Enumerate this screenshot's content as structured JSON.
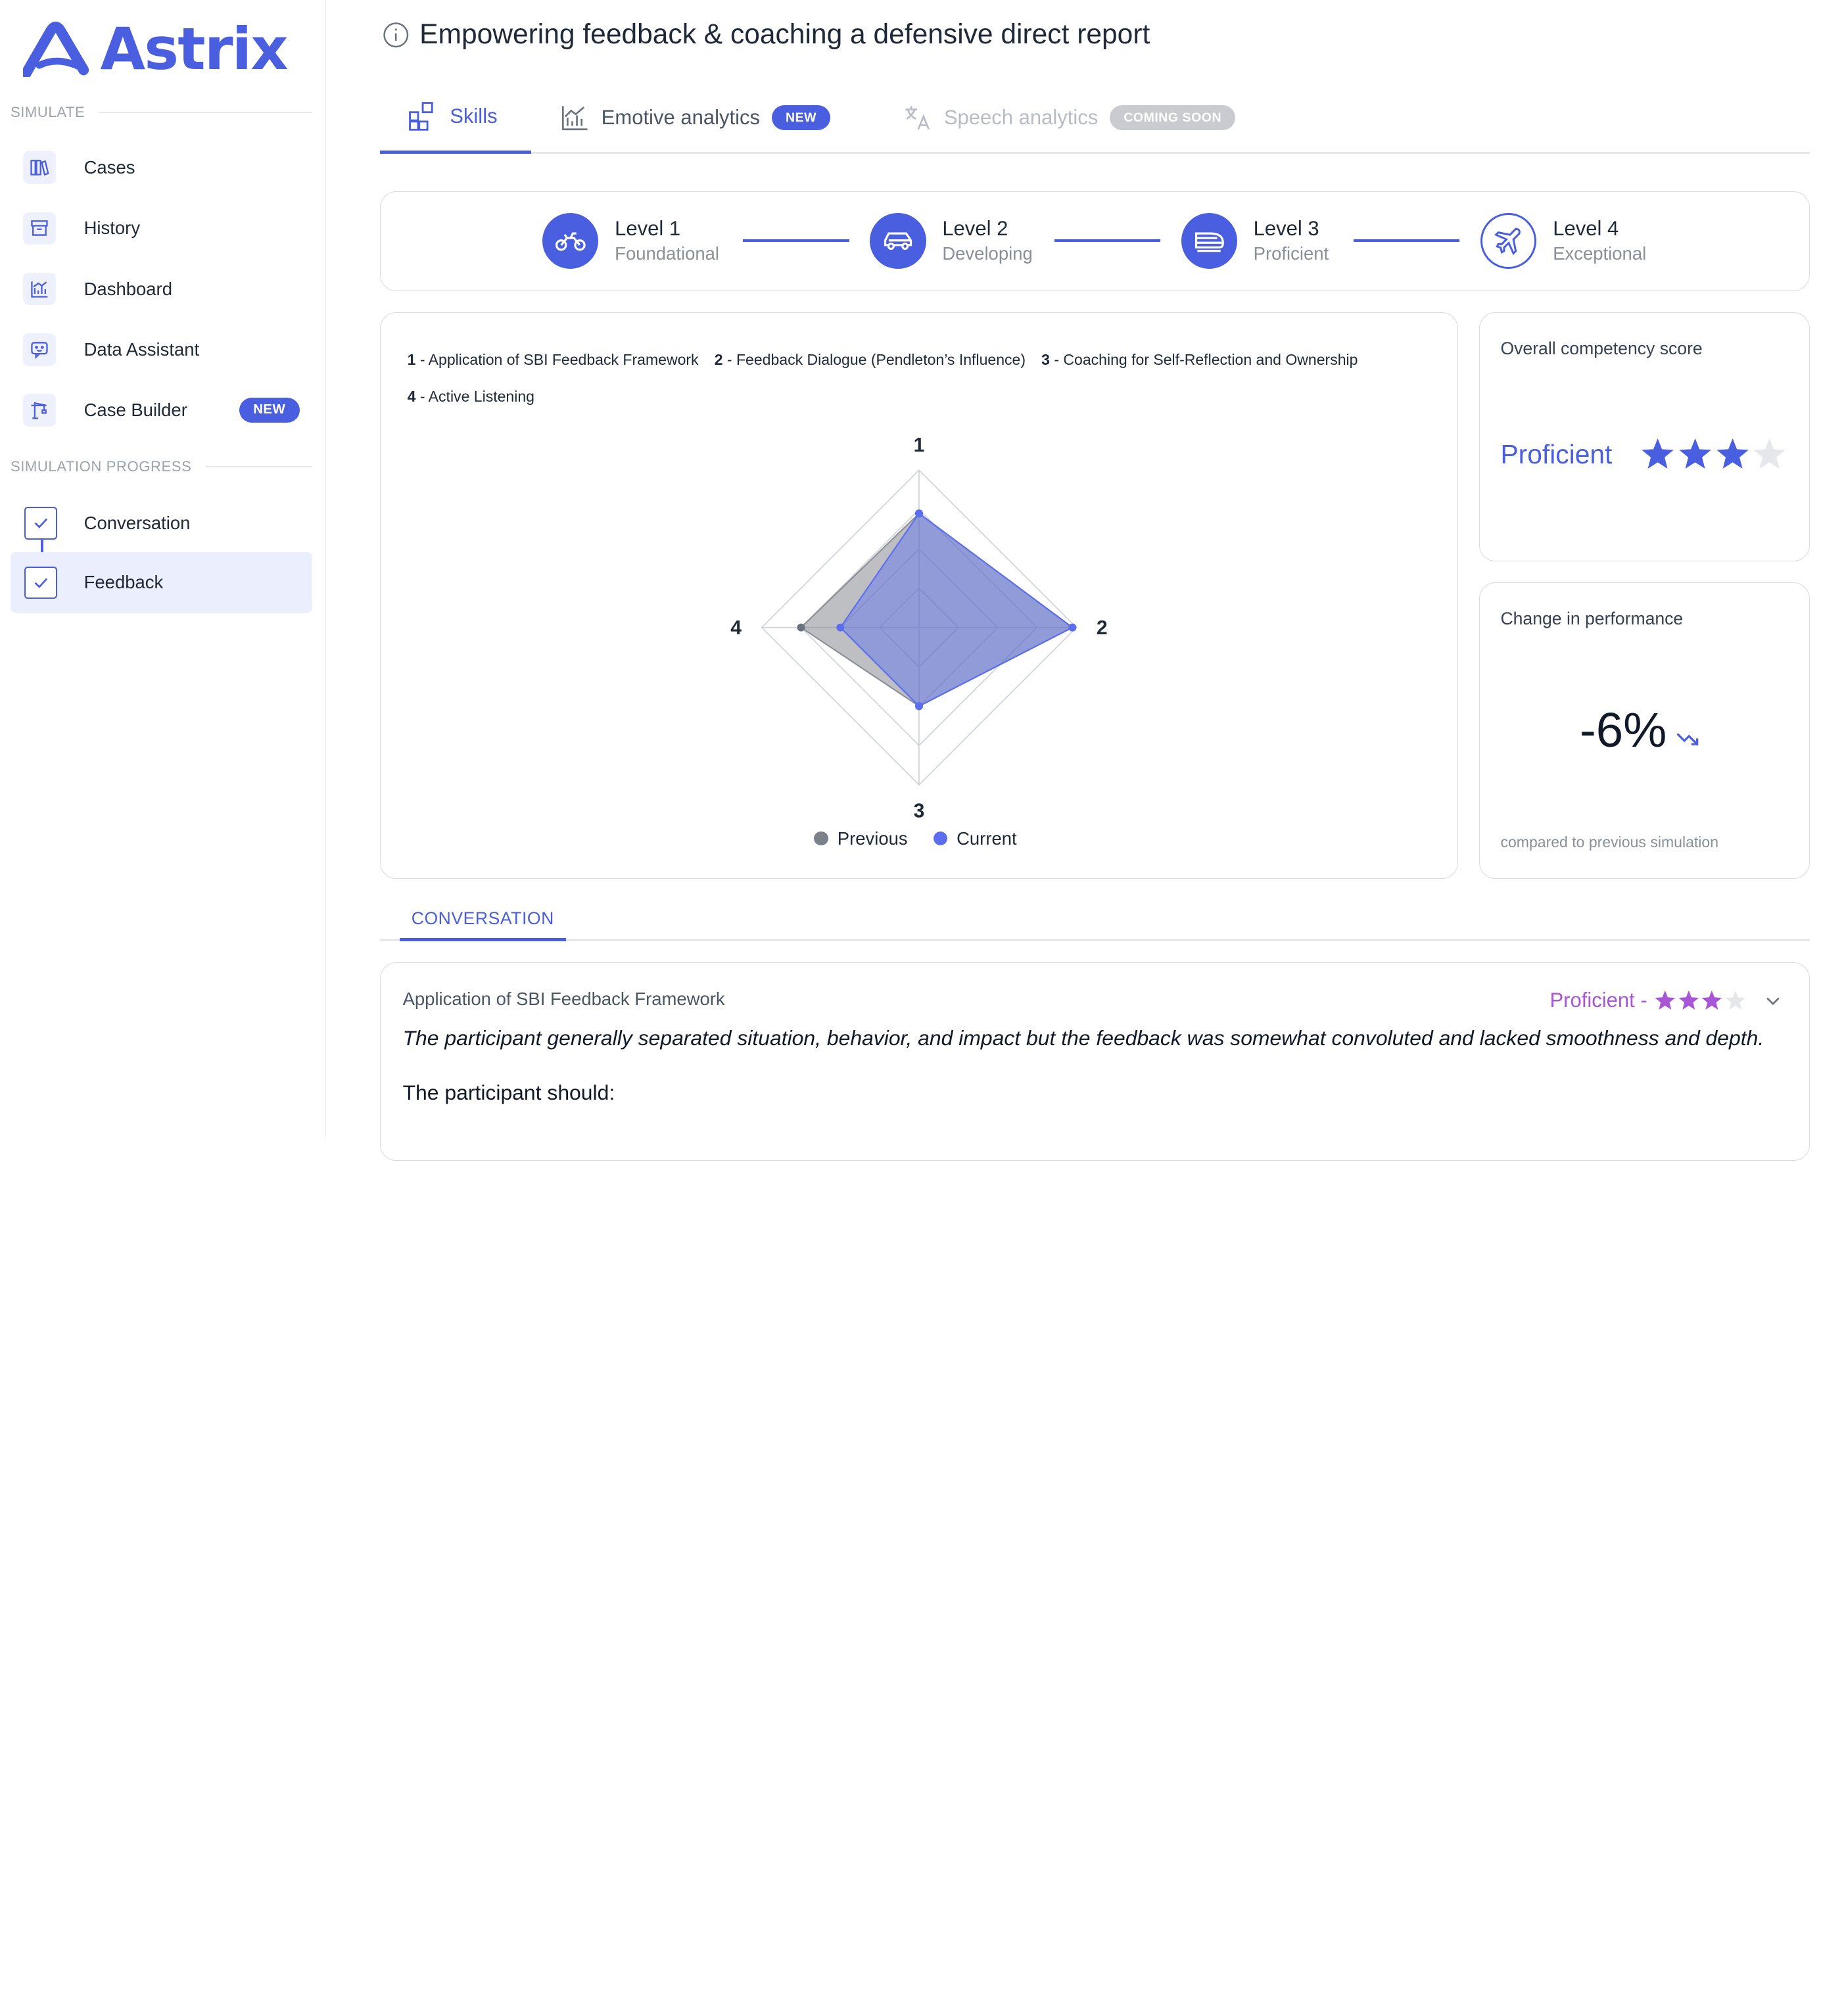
{
  "brand": {
    "name": "Astrix",
    "color": "#4a5ee0"
  },
  "sidebar": {
    "simulate_label": "SIMULATE",
    "items": [
      {
        "label": "Cases",
        "icon": "books-icon"
      },
      {
        "label": "History",
        "icon": "archive-icon"
      },
      {
        "label": "Dashboard",
        "icon": "chart-icon"
      },
      {
        "label": "Data Assistant",
        "icon": "chat-bot-icon"
      },
      {
        "label": "Case Builder",
        "icon": "crane-icon",
        "badge": "NEW"
      }
    ],
    "progress_label": "SIMULATION PROGRESS",
    "progress": [
      {
        "label": "Conversation",
        "done": true
      },
      {
        "label": "Feedback",
        "done": true,
        "active": true
      }
    ]
  },
  "header": {
    "title": "Empowering feedback & coaching a defensive direct report"
  },
  "tabs": [
    {
      "label": "Skills",
      "active": true
    },
    {
      "label": "Emotive analytics",
      "badge": "NEW"
    },
    {
      "label": "Speech analytics",
      "badge": "COMING SOON",
      "disabled": true
    }
  ],
  "levels": [
    {
      "title": "Level 1",
      "subtitle": "Foundational",
      "icon": "motorbike-icon"
    },
    {
      "title": "Level 2",
      "subtitle": "Developing",
      "icon": "car-icon"
    },
    {
      "title": "Level 3",
      "subtitle": "Proficient",
      "icon": "train-icon"
    },
    {
      "title": "Level 4",
      "subtitle": "Exceptional",
      "icon": "plane-icon"
    }
  ],
  "skills_legend": [
    {
      "key": "1",
      "text": " - Application of SBI Feedback Framework"
    },
    {
      "key": "2",
      "text": " - Feedback Dialogue (Pendleton’s Influence)"
    },
    {
      "key": "3",
      "text": " - Coaching for Self-Reflection and Ownership"
    },
    {
      "key": "4",
      "text": " - Active Listening"
    }
  ],
  "chart_data": {
    "type": "radar",
    "axes": [
      "1",
      "2",
      "3",
      "4"
    ],
    "range": [
      0,
      4
    ],
    "rings": 4,
    "series": [
      {
        "name": "Previous",
        "values": [
          2.9,
          3.9,
          2.0,
          3.0
        ],
        "color": "#6b7280"
      },
      {
        "name": "Current",
        "values": [
          2.9,
          3.9,
          2.0,
          2.0
        ],
        "color": "#5b6ef0"
      }
    ]
  },
  "score": {
    "heading": "Overall competency score",
    "value": "Proficient",
    "stars": 3,
    "max_stars": 4
  },
  "performance": {
    "heading": "Change in performance",
    "value": "-6%",
    "footnote": "compared to previous simulation",
    "trend": "down"
  },
  "conversation_tab": {
    "label": "CONVERSATION"
  },
  "detail": {
    "heading": "Application of SBI Feedback Framework",
    "rating_label": "Proficient -",
    "rating_stars": 3,
    "rating_max": 4,
    "rating_color": "#a855d6",
    "description": "The participant generally separated situation, behavior, and impact but the feedback was somewhat convoluted and lacked smoothness and depth.",
    "should": "The participant should:"
  }
}
